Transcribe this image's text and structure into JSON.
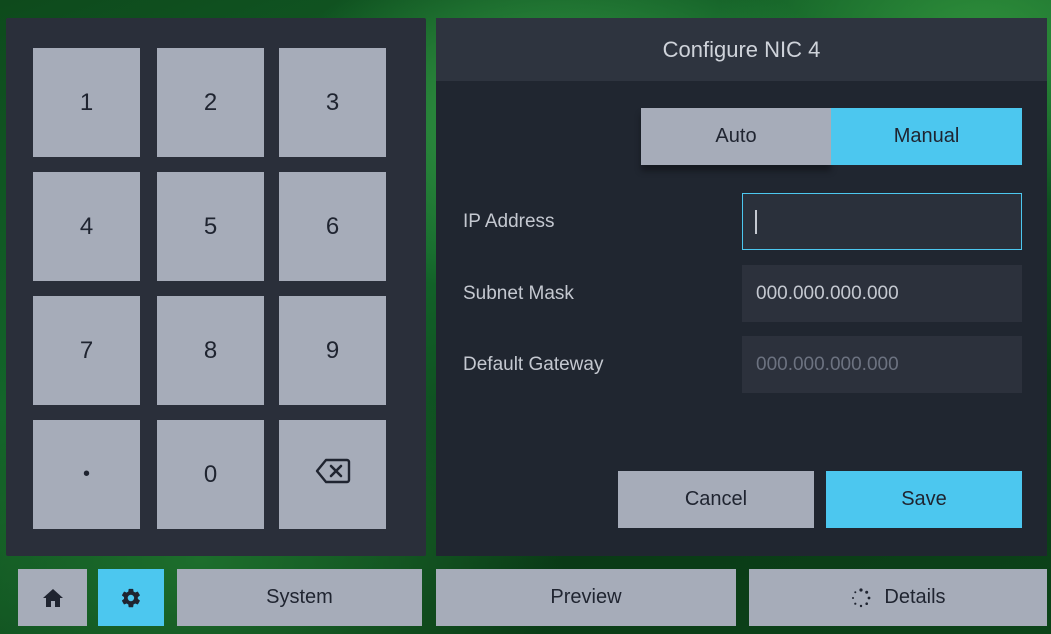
{
  "keypad": {
    "keys": [
      "1",
      "2",
      "3",
      "4",
      "5",
      "6",
      "7",
      "8",
      "9",
      "•",
      "0"
    ],
    "backspace_icon": "backspace-icon"
  },
  "config": {
    "title": "Configure NIC 4",
    "mode_auto": "Auto",
    "mode_manual": "Manual",
    "selected_mode": "Manual",
    "ip_label": "IP Address",
    "ip_value": "",
    "subnet_label": "Subnet Mask",
    "subnet_value": "000.000.000.000",
    "gateway_label": "Default Gateway",
    "gateway_value": "000.000.000.000",
    "cancel_label": "Cancel",
    "save_label": "Save"
  },
  "bottom_bar": {
    "home_icon": "home-icon",
    "settings_icon": "gear-icon",
    "system_label": "System",
    "preview_label": "Preview",
    "details_label": "Details",
    "details_icon": "dotted-circle-icon"
  },
  "colors": {
    "accent": "#4cc7ef",
    "button": "#a6acb9",
    "panel": "#202630"
  }
}
